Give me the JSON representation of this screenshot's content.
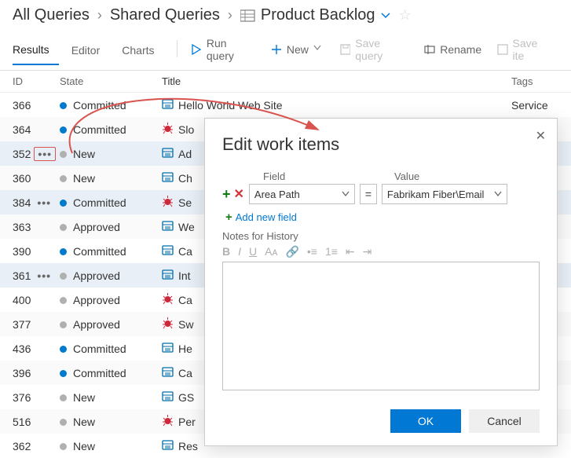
{
  "breadcrumb": {
    "all": "All Queries",
    "shared": "Shared Queries",
    "current": "Product Backlog"
  },
  "tabs": {
    "results": "Results",
    "editor": "Editor",
    "charts": "Charts"
  },
  "toolbar": {
    "run": "Run query",
    "new": "New",
    "save": "Save query",
    "rename": "Rename",
    "save_items": "Save ite"
  },
  "columns": {
    "id": "ID",
    "state": "State",
    "title": "Title",
    "tags": "Tags"
  },
  "state_colors": {
    "committed": "#007acc",
    "new": "#b0b0b0",
    "approved": "#b0b0b0"
  },
  "icon_colors": {
    "book": "#006eab",
    "bug": "#cc293d"
  },
  "rows": [
    {
      "id": "366",
      "state": "Committed",
      "dot": "committed",
      "icon": "book",
      "title": "Hello World Web Site",
      "tags": "Service"
    },
    {
      "id": "364",
      "state": "Committed",
      "dot": "committed",
      "icon": "bug",
      "title": "Slo"
    },
    {
      "id": "352",
      "state": "New",
      "dot": "new",
      "icon": "book",
      "title": "Ad",
      "selected": true,
      "dots_highlight": true
    },
    {
      "id": "360",
      "state": "New",
      "dot": "new",
      "icon": "book",
      "title": "Ch"
    },
    {
      "id": "384",
      "state": "Committed",
      "dot": "committed",
      "icon": "bug",
      "title": "Se",
      "selected": true,
      "show_dots": true
    },
    {
      "id": "363",
      "state": "Approved",
      "dot": "approved",
      "icon": "book",
      "title": "We"
    },
    {
      "id": "390",
      "state": "Committed",
      "dot": "committed",
      "icon": "book",
      "title": "Ca"
    },
    {
      "id": "361",
      "state": "Approved",
      "dot": "approved",
      "icon": "book",
      "title": "Int",
      "selected": true,
      "show_dots": true
    },
    {
      "id": "400",
      "state": "Approved",
      "dot": "approved",
      "icon": "bug",
      "title": "Ca"
    },
    {
      "id": "377",
      "state": "Approved",
      "dot": "approved",
      "icon": "bug",
      "title": "Sw"
    },
    {
      "id": "436",
      "state": "Committed",
      "dot": "committed",
      "icon": "book",
      "title": "He"
    },
    {
      "id": "396",
      "state": "Committed",
      "dot": "committed",
      "icon": "book",
      "title": "Ca"
    },
    {
      "id": "376",
      "state": "New",
      "dot": "new",
      "icon": "book",
      "title": "GS"
    },
    {
      "id": "516",
      "state": "New",
      "dot": "new",
      "icon": "bug",
      "title": "Per"
    },
    {
      "id": "362",
      "state": "New",
      "dot": "new",
      "icon": "book",
      "title": "Res"
    }
  ],
  "dialog": {
    "title": "Edit work items",
    "field_label": "Field",
    "value_label": "Value",
    "field": "Area Path",
    "op": "=",
    "value": "Fabrikam Fiber\\Email",
    "add_field": "Add new field",
    "notes_label": "Notes for History",
    "ok": "OK",
    "cancel": "Cancel"
  }
}
